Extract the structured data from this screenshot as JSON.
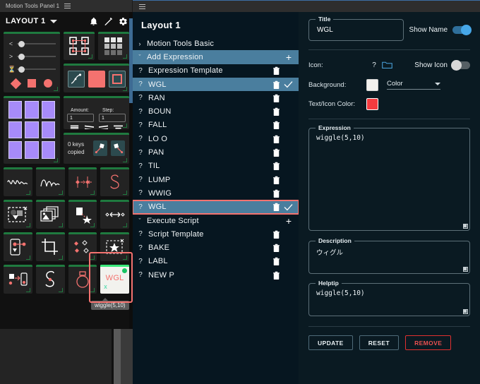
{
  "titlebar": {
    "panel_name": "Motion Tools Panel 1",
    "menu_icon": "hamburger-icon",
    "right_menu_icon": "hamburger-icon"
  },
  "left_panel": {
    "layout_label": "LAYOUT 1",
    "icons": [
      "bell-icon",
      "pen-icon",
      "gear-icon"
    ],
    "amount_label": "Amount:",
    "amount_value": "1",
    "step_label": "Step:",
    "step_value": "1",
    "keys_text": "0 keys copied",
    "selected_tile": {
      "label": "WGL",
      "sub": "x",
      "tooltip": "wiggle(5,10)"
    }
  },
  "mid_panel": {
    "title": "Layout 1",
    "rows": [
      {
        "type": "group",
        "chev": "›",
        "label": "Motion Tools Basic",
        "selected": false,
        "plus": false
      },
      {
        "type": "group",
        "chev": "ˇ",
        "label": "Add Expression",
        "selected": true,
        "plus": true
      },
      {
        "type": "item",
        "label": "Expression Template",
        "selected": false,
        "check": false
      },
      {
        "type": "item",
        "label": "WGL",
        "selected": true,
        "check": true
      },
      {
        "type": "item",
        "label": "RAN",
        "selected": false,
        "check": false
      },
      {
        "type": "item",
        "label": "BOUN",
        "selected": false,
        "check": false
      },
      {
        "type": "item",
        "label": "FALL",
        "selected": false,
        "check": false
      },
      {
        "type": "item",
        "label": "LO O",
        "selected": false,
        "check": false
      },
      {
        "type": "item",
        "label": "PAN",
        "selected": false,
        "check": false
      },
      {
        "type": "item",
        "label": "TIL",
        "selected": false,
        "check": false
      },
      {
        "type": "item",
        "label": "LUMP",
        "selected": false,
        "check": false
      },
      {
        "type": "item",
        "label": "WWIG",
        "selected": false,
        "check": false
      },
      {
        "type": "item",
        "label": "WGL",
        "selected": true,
        "check": true,
        "highlight": true
      },
      {
        "type": "group",
        "chev": "ˇ",
        "label": "Execute Script",
        "selected": false,
        "plus": true
      },
      {
        "type": "item",
        "label": "Script Template",
        "selected": false,
        "check": false
      },
      {
        "type": "item",
        "label": "BAKE",
        "selected": false,
        "check": false
      },
      {
        "type": "item",
        "label": "LABL",
        "selected": false,
        "check": false
      },
      {
        "type": "item",
        "label": "NEW P",
        "selected": false,
        "check": false
      }
    ],
    "question_mark": "?",
    "plus_sign": "+",
    "trash_icon": "trash-icon",
    "check_icon": "check-icon"
  },
  "right_panel": {
    "title_legend": "Title",
    "title_value": "WGL",
    "show_name_label": "Show Name",
    "show_name_on": true,
    "icon_label": "Icon:",
    "icon_qmark": "?",
    "folder_icon": "folder-icon",
    "show_icon_label": "Show Icon",
    "show_icon_on": false,
    "background_label": "Background:",
    "background_color": "#f4f2ee",
    "background_mode": "Color",
    "text_icon_color_label": "Text/Icon Color:",
    "text_icon_color": "#f43b3f",
    "expression_legend": "Expression",
    "expression_value": "wiggle(5,10)",
    "description_legend": "Description",
    "description_value": "ウィグル",
    "helptip_legend": "Helptip",
    "helptip_value": "wiggle(5,10)",
    "buttons": [
      {
        "label": "UPDATE",
        "style": "normal"
      },
      {
        "label": "RESET",
        "style": "normal"
      },
      {
        "label": "REMOVE",
        "style": "danger"
      }
    ]
  }
}
